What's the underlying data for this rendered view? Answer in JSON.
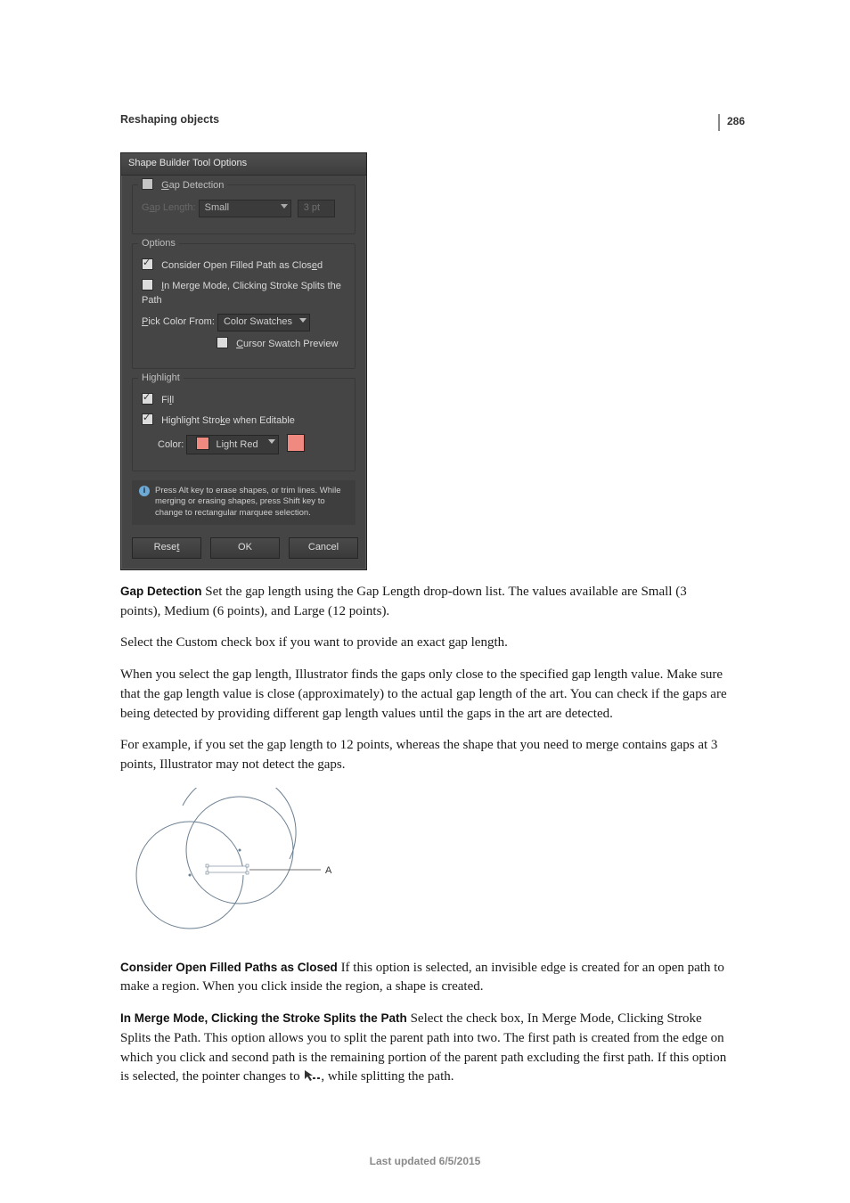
{
  "page_number": "286",
  "section_header": "Reshaping objects",
  "dialog": {
    "title": "Shape Builder Tool Options",
    "gap": {
      "group_label_html": "<span class='ul'>G</span>ap Detection",
      "length_label_html": "G<span class='ul'>a</span>p Length:",
      "length_value": "Small",
      "custom_value": "3 pt"
    },
    "options": {
      "group_label": "Options",
      "open_filled_html": "Consider Open Filled Path as Clos<span class='ul'>e</span>d",
      "merge_splits_html": "<span class='ul'>I</span>n Merge Mode, Clicking Stroke Splits the Path",
      "pick_from_label_html": "<span class='ul'>P</span>ick Color From:",
      "pick_from_value": "Color Swatches",
      "cursor_preview_html": "<span class='ul'>C</span>ursor Swatch Preview"
    },
    "highlight": {
      "group_label": "Highlight",
      "fill_html": "Fi<span class='ul'>l</span>l",
      "stroke_html": "Highlight Stro<span class='ul'>k</span>e when Editable",
      "color_label": "Color:",
      "color_value": "Light Red"
    },
    "info_text": "Press Alt key to erase shapes, or trim lines. While merging or erasing shapes, press Shift key to change to rectangular marquee selection.",
    "buttons": {
      "reset_html": "Rese<span class='ul'>t</span>",
      "ok": "OK",
      "cancel": "Cancel"
    }
  },
  "body": {
    "gap_term": "Gap Detection",
    "gap_text": "  Set the gap length using the Gap Length drop-down list. The values available are Small (3 points), Medium (6 points), and Large (12 points).",
    "p2": "Select the Custom check box if you want to provide an exact gap length.",
    "p3": "When you select the gap length, Illustrator finds the gaps only close to the specified gap length value. Make sure that the gap length value is close (approximately) to the actual gap length of the art. You can check if the gaps are being detected by providing different gap length values until the gaps in the art are detected.",
    "p4": "For example, if you set the gap length to 12 points, whereas the shape that you need to merge contains gaps at 3 points, Illustrator may not detect the gaps.",
    "fig_label": "A",
    "open_term": "Consider Open Filled Paths as Closed",
    "open_text": "  If this option is selected, an invisible edge is created for an open path to make a region. When you click inside the region, a shape is created.",
    "merge_term": "In Merge Mode, Clicking the Stroke Splits the Path",
    "merge_text_a": "  Select the check box, In Merge Mode, Clicking Stroke Splits the Path. This option allows you to split the parent path into two. The first path is created from the edge on which you click and second path is the remaining portion of the parent path excluding the first path. If this option is selected, the pointer changes to ",
    "merge_text_b": ", while splitting the path."
  },
  "footer": "Last updated 6/5/2015"
}
